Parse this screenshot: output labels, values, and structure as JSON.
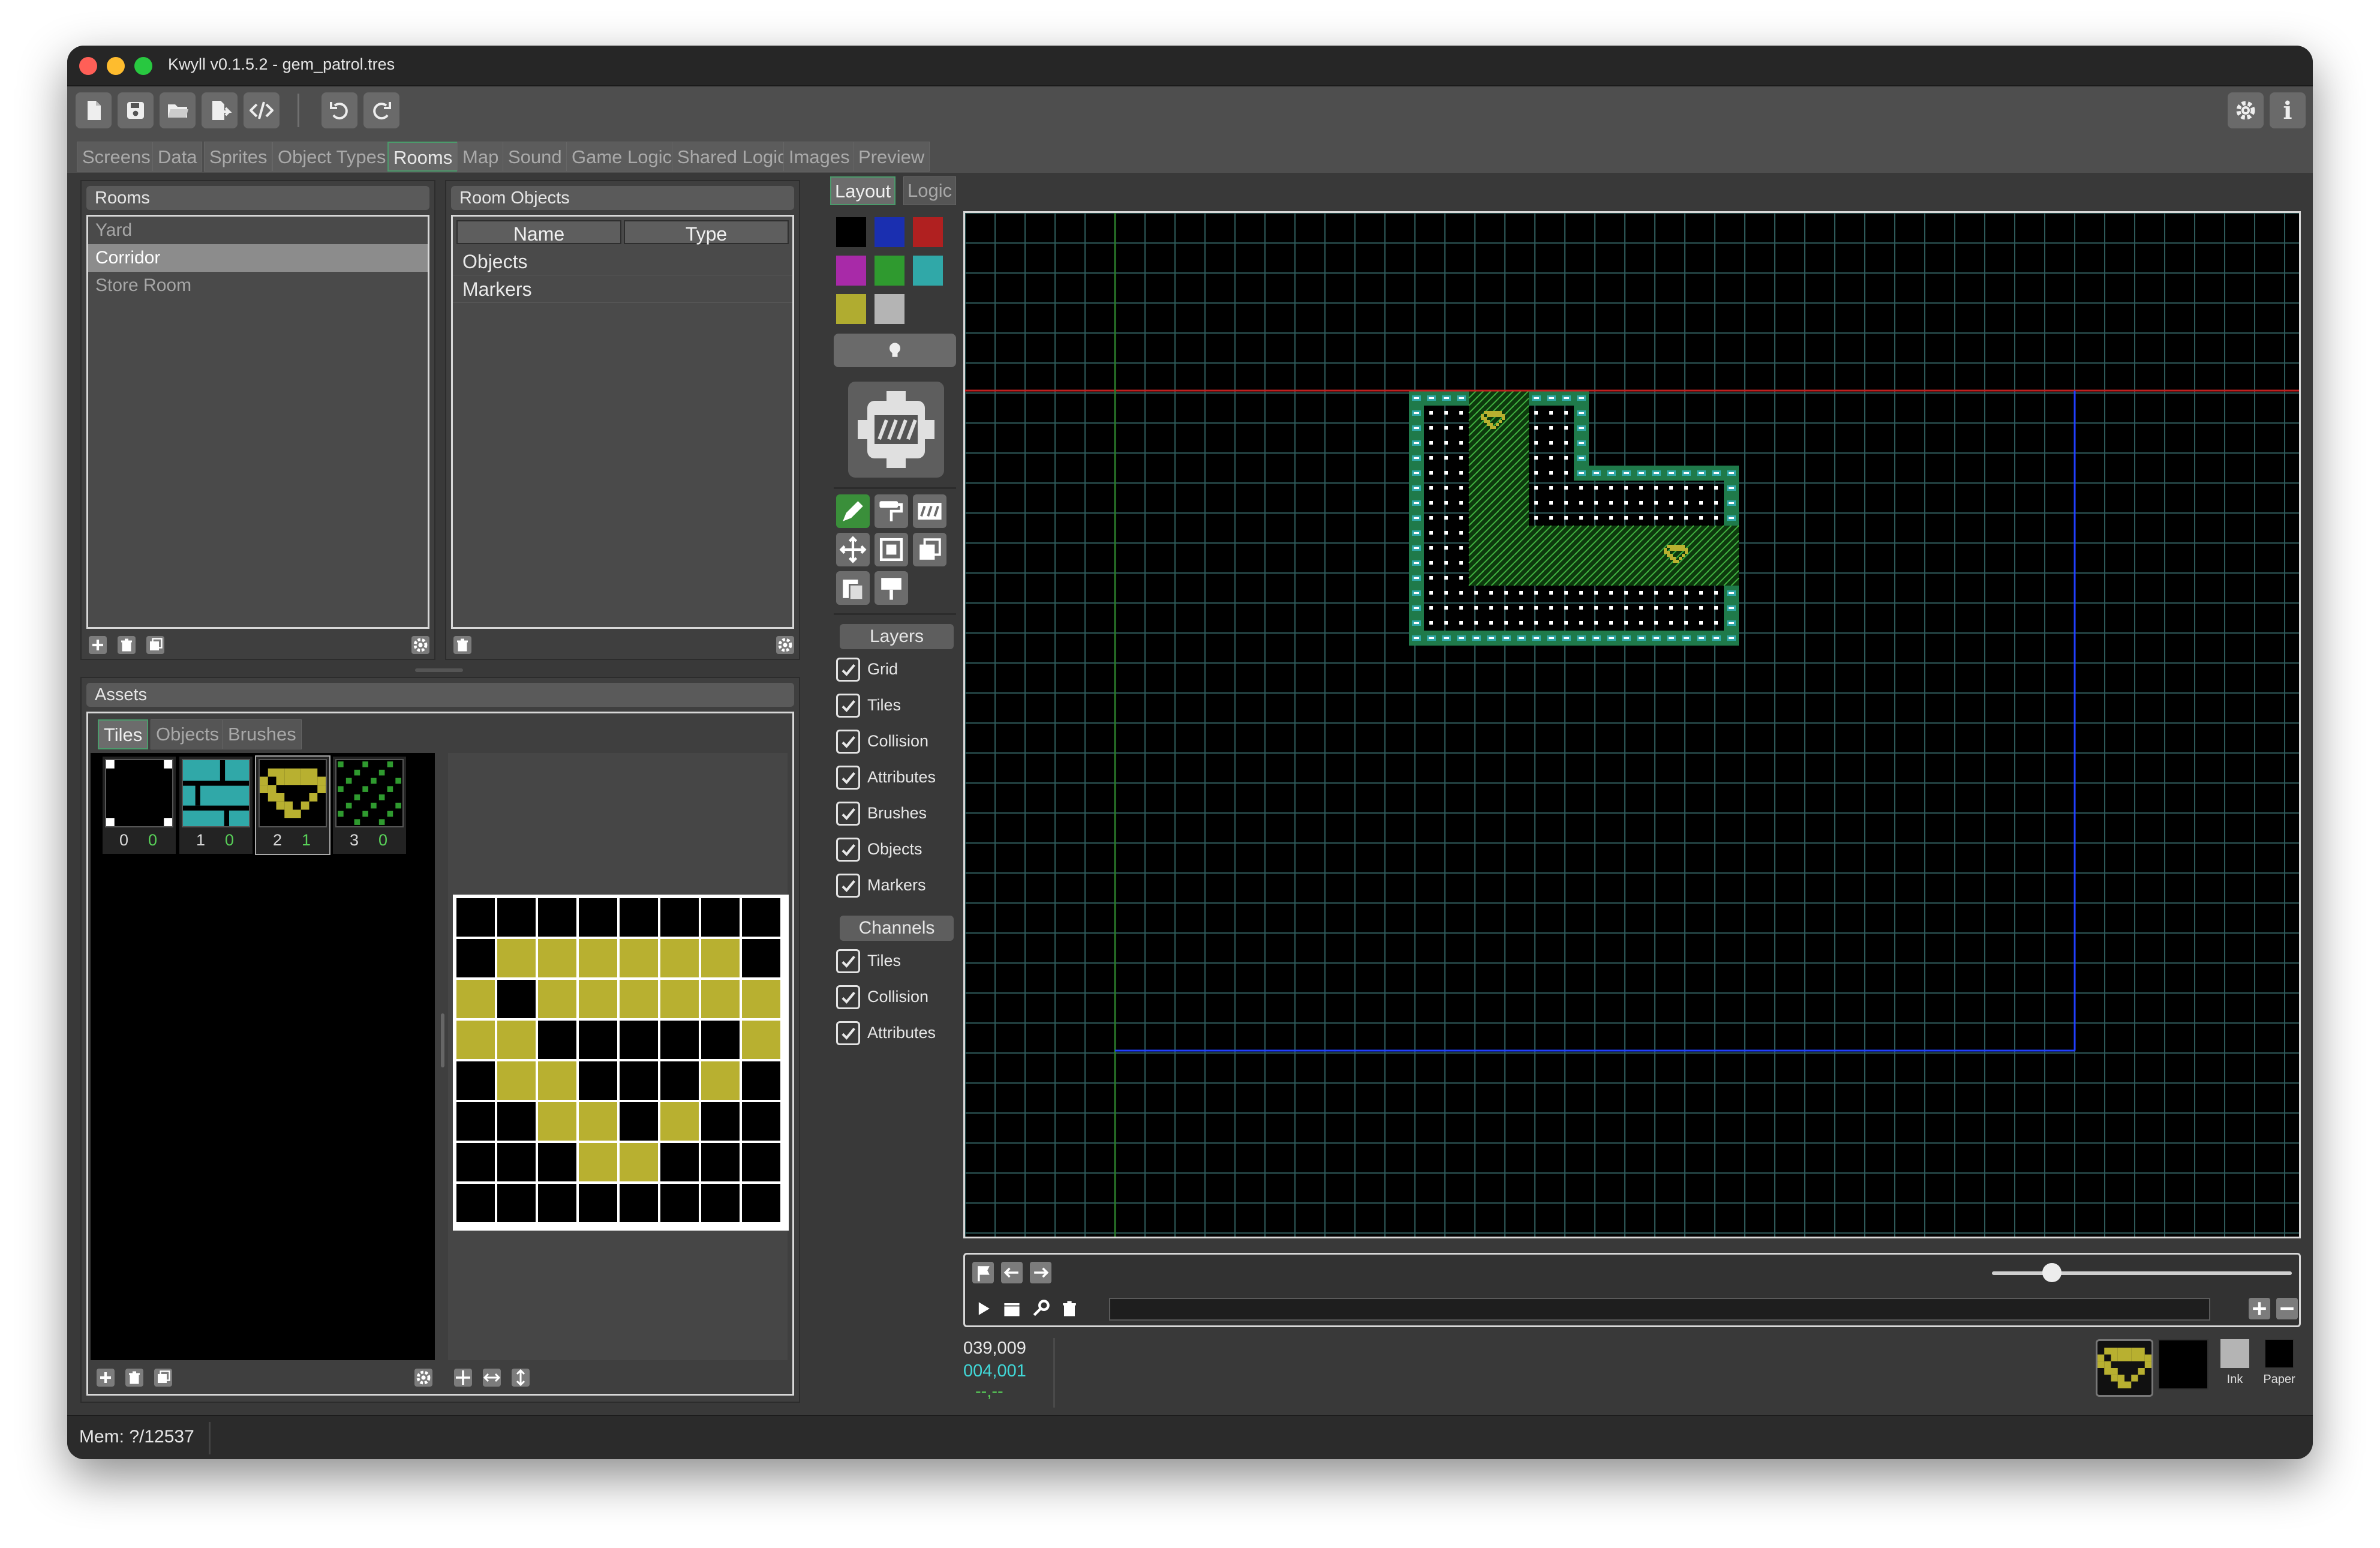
{
  "window": {
    "title": "Kwyll v0.1.5.2 - gem_patrol.tres"
  },
  "colors": {
    "accent": "#4c9b6c",
    "map_bg": "#000000",
    "grid": "#2e5a5a",
    "red_guide": "#c02020",
    "blue_guide": "#2040ff",
    "green_guide": "#2a7a2a",
    "coord_cyan": "#40d8d8",
    "coord_green": "#58d058",
    "gem_yellow": "#b8b030"
  },
  "toolbar": {
    "left_icons": [
      "new-file-icon",
      "save-icon",
      "open-folder-icon",
      "export-icon",
      "code-icon",
      "undo-icon",
      "redo-icon"
    ],
    "right_icons": [
      "gear-icon",
      "info-icon"
    ],
    "info_label": "i"
  },
  "tabs": [
    "Screens",
    "Data",
    "Sprites",
    "Object Types",
    "Rooms",
    "Map",
    "Sound",
    "Game Logic",
    "Shared Logic",
    "Images",
    "Preview"
  ],
  "active_tab": "Rooms",
  "rooms_panel": {
    "title": "Rooms",
    "items": [
      "Yard",
      "Corridor",
      "Store Room"
    ],
    "selected": "Corridor"
  },
  "room_objects_panel": {
    "title": "Room Objects",
    "columns": [
      "Name",
      "Type"
    ],
    "rows": [
      "Objects",
      "Markers"
    ]
  },
  "assets_panel": {
    "title": "Assets",
    "tabs": [
      "Tiles",
      "Objects",
      "Brushes"
    ],
    "active_tab": "Tiles",
    "tiles": [
      {
        "num": "0",
        "count": "0",
        "kind": "blank"
      },
      {
        "num": "1",
        "count": "0",
        "kind": "brick"
      },
      {
        "num": "2",
        "count": "1",
        "kind": "gem"
      },
      {
        "num": "3",
        "count": "0",
        "kind": "dots"
      }
    ],
    "selected_tile": "2"
  },
  "editor_tabs": {
    "items": [
      "Layout",
      "Logic"
    ],
    "active": "Layout"
  },
  "palette": [
    "#000000",
    "#1a2fb0",
    "#b02020",
    "#a82aa8",
    "#2f9a2f",
    "#30a8a8",
    "#b0ac30",
    "#b4b4b4"
  ],
  "layers": {
    "title": "Layers",
    "items": [
      "Grid",
      "Tiles",
      "Collision",
      "Attributes",
      "Brushes",
      "Objects",
      "Markers"
    ]
  },
  "channels": {
    "title": "Channels",
    "items": [
      "Tiles",
      "Collision",
      "Attributes"
    ]
  },
  "coords": {
    "line1": "039,009",
    "line2": "004,001",
    "line3": "--,--"
  },
  "color_select": {
    "ink_label": "Ink",
    "paper_label": "Paper"
  },
  "zoom_level": 0.2,
  "status": {
    "mem": "Mem: ?/12537"
  }
}
